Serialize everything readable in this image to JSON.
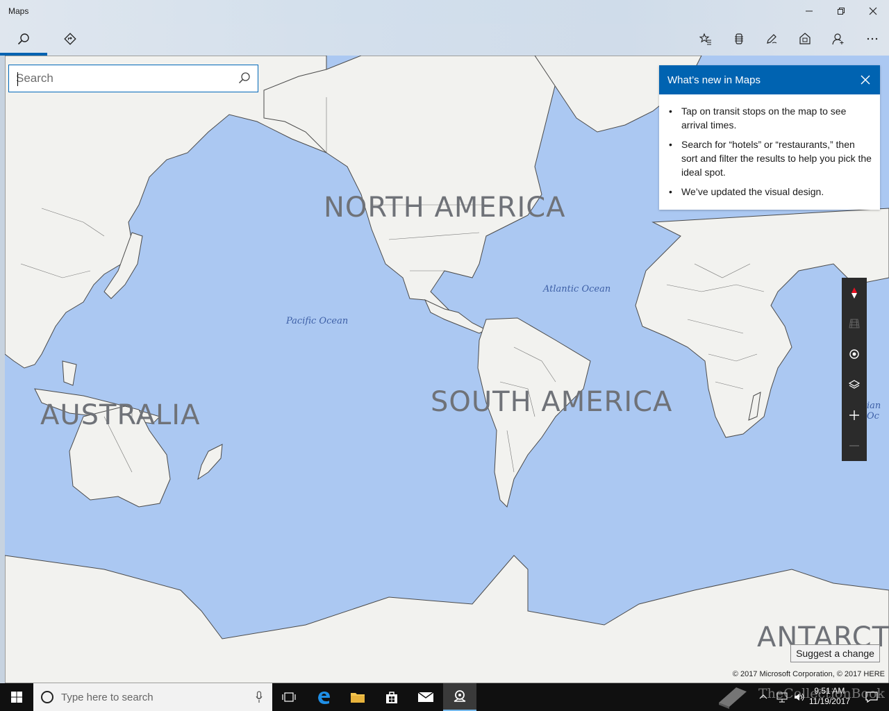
{
  "app": {
    "title": "Maps"
  },
  "window_controls": {
    "icons": [
      "minimize-icon",
      "restore-icon",
      "close-icon"
    ]
  },
  "toolbar": {
    "left": [
      "search-icon",
      "directions-icon"
    ],
    "right": [
      "favorites-icon",
      "ink-icon",
      "pen-icon",
      "traffic-icon",
      "account-icon",
      "more-icon"
    ]
  },
  "search": {
    "placeholder": "Search",
    "value": ""
  },
  "whats_new": {
    "title": "What’s new in Maps",
    "items": [
      "Tap on transit stops on the map to see arrival times.",
      "Search for “hotels” or “restaurants,” then sort and filter the results to help you pick the ideal spot.",
      "We’ve updated the visual design."
    ]
  },
  "map": {
    "labels": {
      "north_america": "NORTH AMERICA",
      "south_america": "SOUTH AMERICA",
      "australia": "AUSTRALIA",
      "antarctica": "ANTARCTI",
      "atlantic": "Atlantic Ocean",
      "pacific": "Pacific Ocean",
      "indian_partial": "ian Oc"
    },
    "colors": {
      "water": "#abc8f2",
      "land": "#f2f2ef",
      "border": "#333333"
    }
  },
  "map_controls": [
    "compass-icon",
    "tilt-icon",
    "my-location-icon",
    "layers-icon",
    "zoom-in-icon",
    "zoom-out-icon"
  ],
  "suggest_change": "Suggest a change",
  "copyright": "© 2017 Microsoft Corporation, © 2017 HERE",
  "taskbar": {
    "search_placeholder": "Type here to search",
    "time": "9:51 AM",
    "date": "11/19/2017",
    "watermark": "TheCollectionBook"
  }
}
